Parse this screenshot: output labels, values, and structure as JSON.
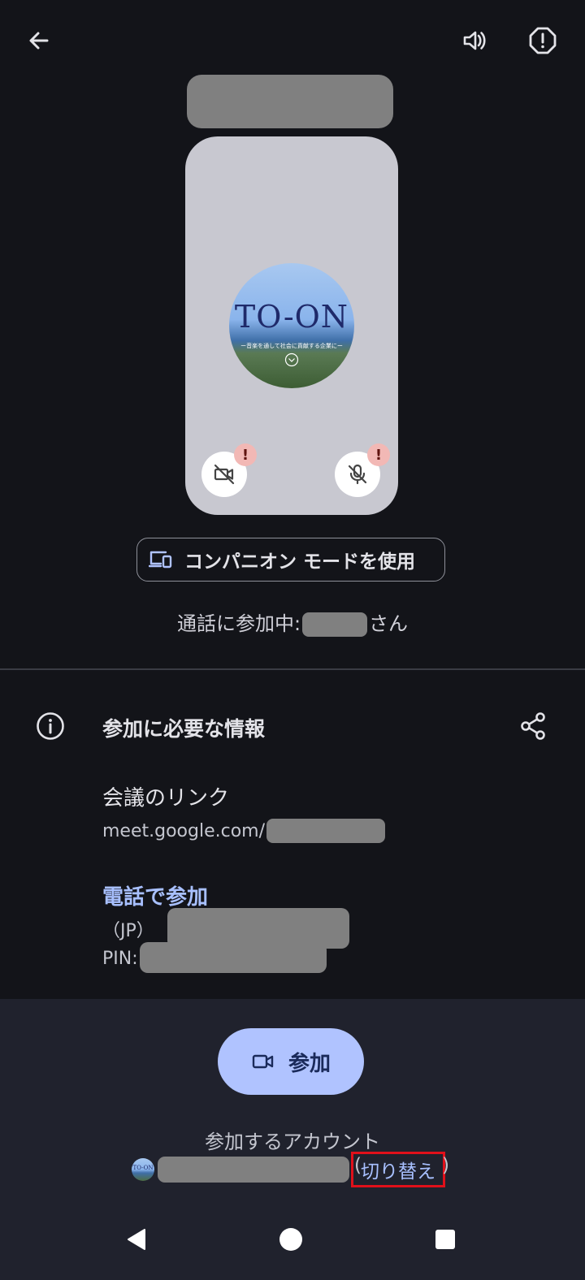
{
  "header": {
    "back_icon": "arrow-left-icon",
    "speaker_icon": "volume-icon",
    "report_icon": "alert-octagon-icon"
  },
  "preview": {
    "avatar_logo_text": "TO-ON",
    "avatar_tagline": "ー音楽を通して社会に貢献する企業にー",
    "camera_icon": "camera-off-icon",
    "mic_icon": "mic-off-icon",
    "warning_mark": "!"
  },
  "companion": {
    "label": "コンパニオン モードを使用",
    "icon": "companion-devices-icon"
  },
  "joining": {
    "prefix": "通話に参加中:",
    "suffix": "さん"
  },
  "info": {
    "title": "参加に必要な情報",
    "info_icon": "info-icon",
    "share_icon": "share-icon",
    "link_label": "会議のリンク",
    "link_prefix": "meet.google.com/",
    "phone_label": "電話で参加",
    "phone_country": "（JP）",
    "pin_label": "PIN:"
  },
  "footer": {
    "join_label": "参加",
    "join_icon": "video-camera-icon",
    "account_label": "参加するアカウント",
    "avatar_text": "TO-ON",
    "switch_label": "切り替え",
    "open_paren": "(",
    "close_paren": ")"
  },
  "navbar": {
    "back_icon": "nav-back-icon",
    "home_icon": "nav-home-icon",
    "recents_icon": "nav-recents-icon"
  },
  "colors": {
    "background": "#131419",
    "panel": "#20222d",
    "accent": "#b0c3ff",
    "link": "#a8c0ff",
    "highlight": "#e0101a"
  }
}
